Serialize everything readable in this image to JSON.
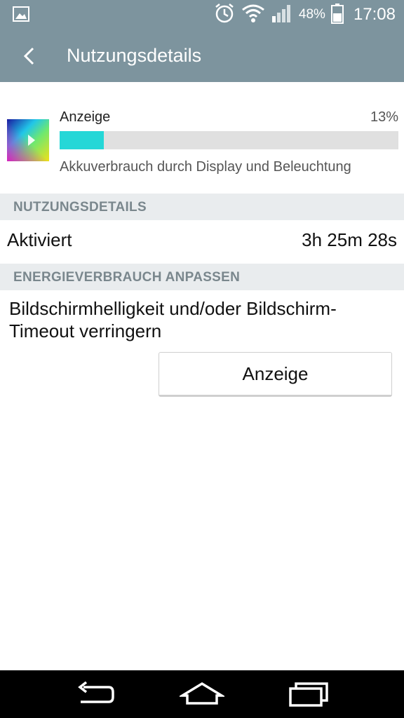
{
  "status_bar": {
    "battery_percent": "48%",
    "time": "17:08",
    "icons": [
      "image-icon",
      "alarm-icon",
      "wifi-icon",
      "signal-icon",
      "battery-icon"
    ]
  },
  "app_bar": {
    "title": "Nutzungsdetails",
    "back_icon": "back-chevron-icon"
  },
  "usage": {
    "name": "Anzeige",
    "percent": "13%",
    "fill_fraction": 0.13,
    "description": "Akkuverbrauch durch Display und Beleuchtung",
    "bar_color": "#25d7d7"
  },
  "sections": {
    "usage_details_header": "NUTZUNGSDETAILS",
    "activated_label": "Aktiviert",
    "activated_value": "3h 25m 28s",
    "adjust_header": "ENERGIEVERBRAUCH ANPASSEN",
    "advice": "Bildschirmhelligkeit und/oder Bildschirm-Timeout verringern",
    "button_label": "Anzeige"
  },
  "nav_bar": {
    "icons": [
      "back-icon",
      "home-icon",
      "recent-apps-icon"
    ]
  },
  "colors": {
    "app_bar": "#7d949e",
    "section_header_bg": "#e9ecee",
    "section_header_text": "#7a878d"
  }
}
